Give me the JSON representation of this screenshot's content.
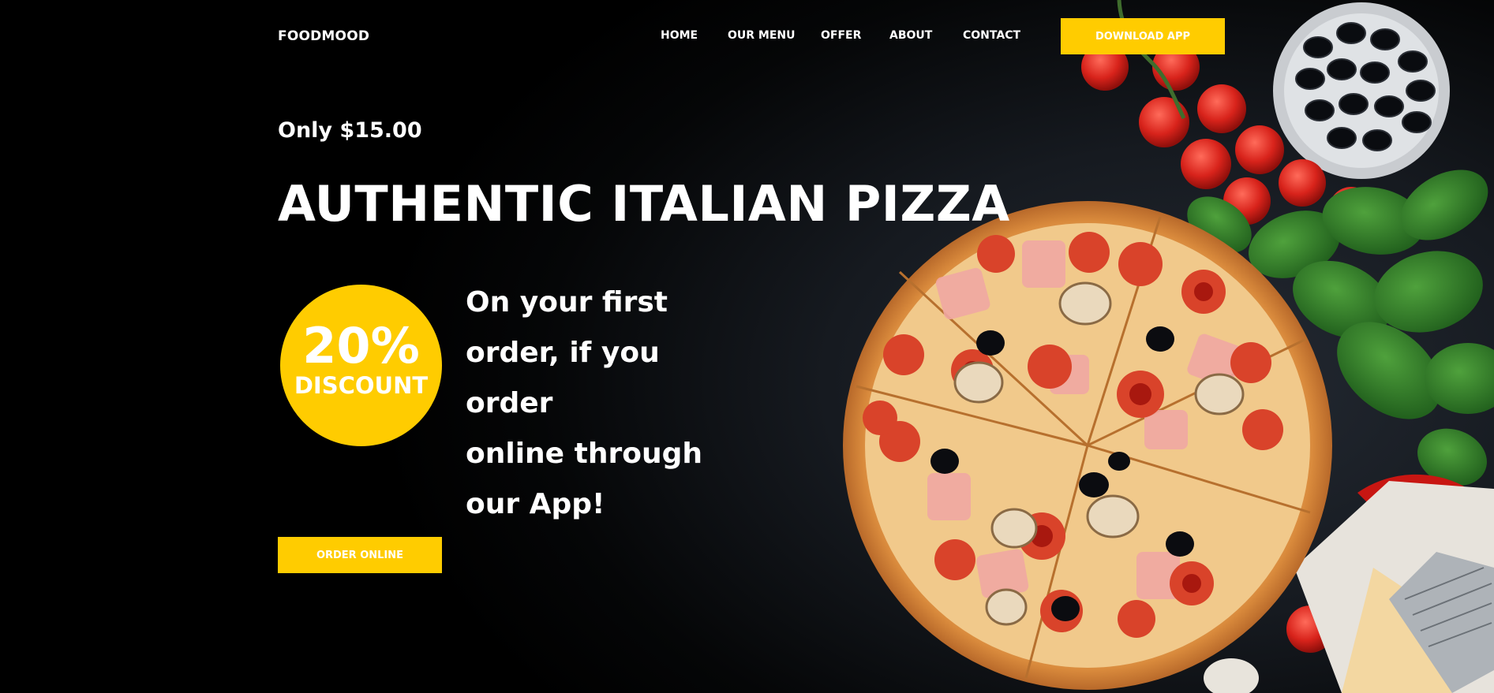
{
  "brand": {
    "logo": "FOODMOOD"
  },
  "nav": {
    "items": [
      "HOME",
      "OUR MENU",
      "OFFER",
      "ABOUT",
      "CONTACT"
    ],
    "download_label": "DOWNLOAD APP"
  },
  "hero": {
    "price": "Only $15.00",
    "title": "AUTHENTIC ITALIAN PIZZA",
    "discount_percent": "20%",
    "discount_label": "DISCOUNT",
    "offer_lines": [
      "On your first",
      "order, if you order",
      "online through",
      "our App!"
    ],
    "order_label": "ORDER ONLINE"
  },
  "colors": {
    "accent": "#ffcc00",
    "background": "#000000",
    "text": "#ffffff"
  }
}
